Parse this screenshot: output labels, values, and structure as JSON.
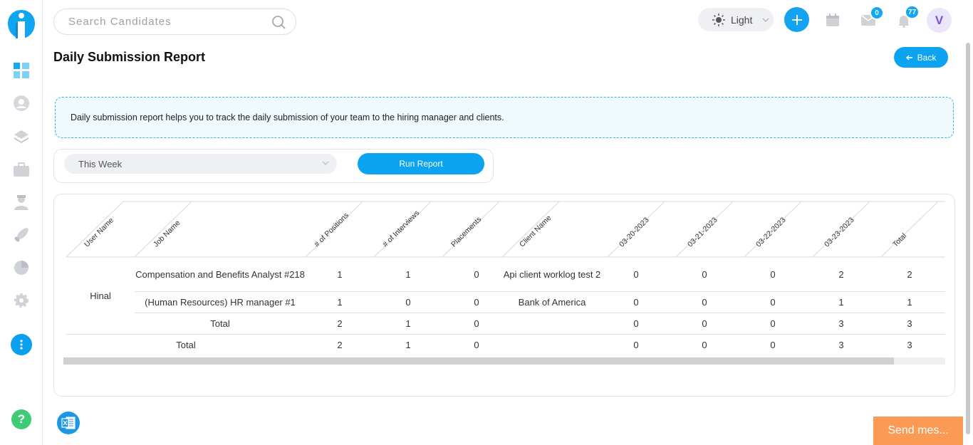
{
  "search": {
    "placeholder": "Search Candidates"
  },
  "header": {
    "theme_label": "Light",
    "mail_badge": "0",
    "notification_badge": "77",
    "avatar_initial": "V"
  },
  "page": {
    "title": "Daily Submission Report",
    "back_label": "Back",
    "info_text": "Daily submission report helps you to track the daily submission of your team to the hiring manager and clients."
  },
  "filters": {
    "period_value": "This Week",
    "run_label": "Run Report"
  },
  "table": {
    "headers": [
      "User Name",
      "Job Name",
      "# of Positions",
      "# of Interviews",
      "Placements",
      "Client Name",
      "03-20-2023",
      "03-21-2023",
      "03-22-2023",
      "03-23-2023",
      "Total"
    ],
    "groups": [
      {
        "user": "Hinal",
        "rows": [
          {
            "job": "Compensation and Benefits Analyst #218",
            "positions": "1",
            "interviews": "1",
            "placements": "0",
            "client": "Api client worklog test 2",
            "d1": "0",
            "d2": "0",
            "d3": "0",
            "d4": "2",
            "total": "2"
          },
          {
            "job": "(Human Resources) HR manager #1",
            "positions": "1",
            "interviews": "0",
            "placements": "0",
            "client": "Bank of America",
            "d1": "0",
            "d2": "0",
            "d3": "0",
            "d4": "1",
            "total": "1"
          }
        ],
        "subtotal": {
          "label": "Total",
          "positions": "2",
          "interviews": "1",
          "placements": "0",
          "client": "",
          "d1": "0",
          "d2": "0",
          "d3": "0",
          "d4": "3",
          "total": "3"
        }
      }
    ],
    "grand_total": {
      "label": "Total",
      "positions": "2",
      "interviews": "1",
      "placements": "0",
      "client": "",
      "d1": "0",
      "d2": "0",
      "d3": "0",
      "d4": "3",
      "total": "3"
    }
  },
  "chat": {
    "label": "Send mes..."
  },
  "help": {
    "label": "?"
  },
  "colors": {
    "accent": "#0ca3f0",
    "chat": "#fa9a55",
    "help": "#3fca75"
  }
}
